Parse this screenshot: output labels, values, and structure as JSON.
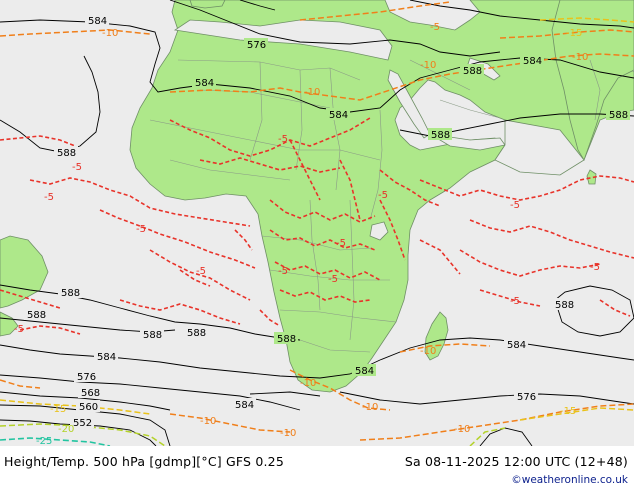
{
  "footer": {
    "left_text": "Height/Temp. 500 hPa [gdmp][°C] GFS 0.25",
    "right_text": "Sa 08-11-2025 12:00 UTC (12+48)",
    "credit": "©weatheronline.co.uk"
  },
  "colors": {
    "ocean": "#ececec",
    "land": "#aee88a",
    "country_border": "#8a9a86",
    "height_contour": "#000000",
    "temp_minus5": "#e8332a",
    "temp_minus10": "#f07f1a",
    "temp_minus15": "#e9c21a",
    "temp_minus20": "#b4d22a",
    "temp_minus25": "#22c4a0"
  },
  "height_labels": {
    "h584_nw": "584",
    "h576_n": "576",
    "h584_nc": "584",
    "h584_c": "584",
    "h588_ne": "588",
    "h584_ne": "584",
    "h588_e": "588",
    "h588_me": "588",
    "h588_w": "588",
    "h588_sw1": "588",
    "h588_sw2": "588",
    "h588_sw3": "588",
    "h588_sw4": "588",
    "h588_sa": "588",
    "h584_sw": "584",
    "h576_sw": "576",
    "h568_sw": "568",
    "h560_sw": "560",
    "h552_sw": "552",
    "h584_s": "584",
    "h584_se": "584",
    "h584_madag": "584",
    "h588_se": "588",
    "h576_se": "576"
  },
  "temp_labels": {
    "t10_nw": "-10",
    "t5_nw": "-5",
    "t5_ne": "-5",
    "t10_n": "-10",
    "t10_ne": "-10",
    "t10_ne2": "-10",
    "t15_ne": "-15",
    "t5_w1": "-5",
    "t5_w2": "-5",
    "t5_w3": "-5",
    "t5_c1": "-5",
    "t5_c2": "-5",
    "t5_c3": "-5",
    "t5_c4": "-5",
    "t5_e1": "-5",
    "t5_e2": "-5",
    "t5_e3": "-5",
    "t5_e4": "-5",
    "t5_sw": "-5",
    "t10_sa": "-10",
    "t10_sa2": "-10",
    "t10_s": "-10",
    "t10_madag": "-10",
    "t10_sw": "-10",
    "t15_sw": "-15",
    "t20_sw": "-20",
    "t25_sw": "-25",
    "t15_se": "-15",
    "t10_se": "-10"
  }
}
